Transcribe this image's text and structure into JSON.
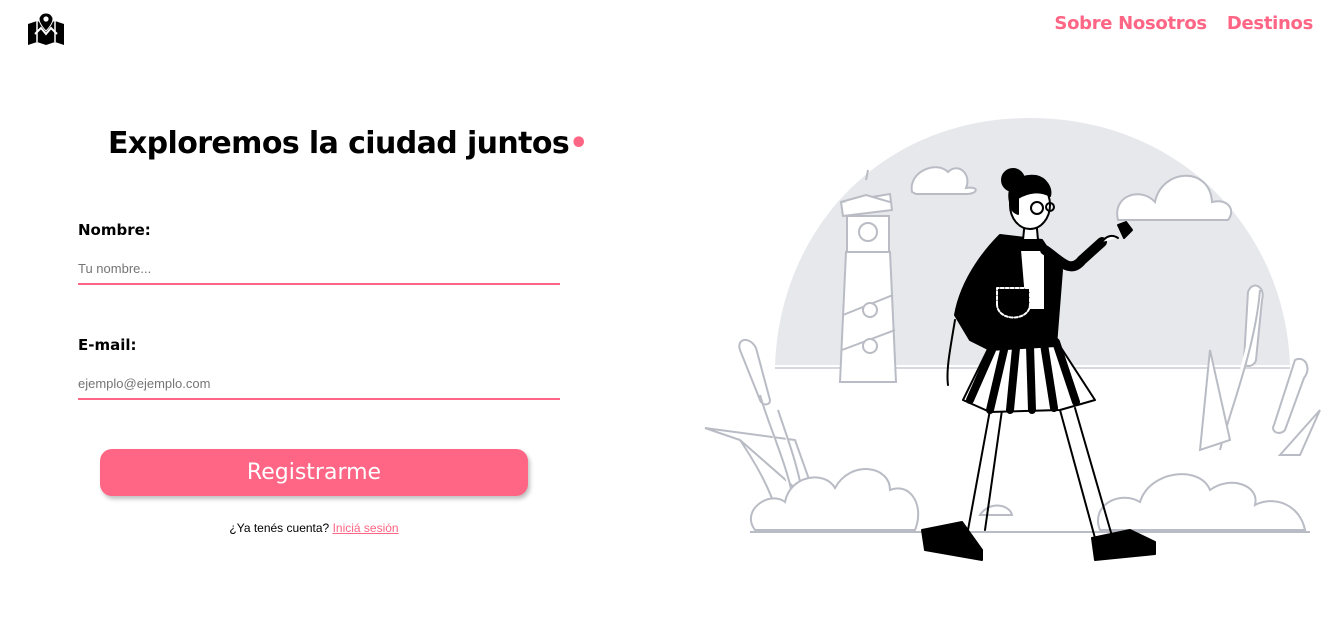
{
  "header": {
    "logo_icon": "map-pin-icon",
    "nav": [
      {
        "label": "Sobre Nosotros"
      },
      {
        "label": "Destinos"
      }
    ]
  },
  "form": {
    "title": "Exploremos la ciudad juntos",
    "title_dot": "•",
    "name_label": "Nombre:",
    "name_placeholder": "Tu nombre...",
    "email_label": "E-mail:",
    "email_placeholder": "ejemplo@ejemplo.com",
    "submit_label": "Registrarme",
    "login_prompt": "¿Ya tenés cuenta?",
    "login_link": "Iniciá sesión"
  },
  "colors": {
    "accent": "#ff6584",
    "text": "#000000",
    "illustration_bg": "#e6e8ec"
  },
  "illustration": {
    "icon": "woman-walking-with-phone-illustration"
  }
}
